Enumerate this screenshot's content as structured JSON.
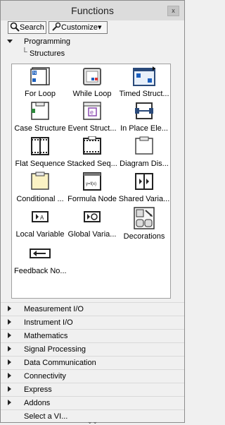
{
  "title": "Functions",
  "close_label": "x",
  "toolbar": {
    "search_label": "Search",
    "customize_label": "Customize",
    "customize_arrow": "▾"
  },
  "tree": {
    "programming": "Programming",
    "structures_connector": "└",
    "structures": "Structures"
  },
  "structures_items": [
    {
      "label": "For Loop",
      "icon": "for-loop-icon"
    },
    {
      "label": "While Loop",
      "icon": "while-loop-icon"
    },
    {
      "label": "Timed Struct...",
      "icon": "timed-structure-icon"
    },
    {
      "label": "Case Structure",
      "icon": "case-structure-icon"
    },
    {
      "label": "Event Struct...",
      "icon": "event-structure-icon"
    },
    {
      "label": "In Place Ele...",
      "icon": "in-place-element-icon"
    },
    {
      "label": "Flat Sequence",
      "icon": "flat-sequence-icon"
    },
    {
      "label": "Stacked Seq...",
      "icon": "stacked-sequence-icon"
    },
    {
      "label": "Diagram Dis...",
      "icon": "diagram-disable-icon"
    },
    {
      "label": "Conditional ...",
      "icon": "conditional-disable-icon"
    },
    {
      "label": "Formula Node",
      "icon": "formula-node-icon"
    },
    {
      "label": "Shared Varia...",
      "icon": "shared-variable-icon"
    },
    {
      "label": "Local Variable",
      "icon": "local-variable-icon"
    },
    {
      "label": "Global Varia...",
      "icon": "global-variable-icon"
    },
    {
      "label": "Decorations",
      "icon": "decorations-icon"
    },
    {
      "label": "Feedback No...",
      "icon": "feedback-node-icon"
    }
  ],
  "categories": [
    "Measurement I/O",
    "Instrument I/O",
    "Mathematics",
    "Signal Processing",
    "Data Communication",
    "Connectivity",
    "Express",
    "Addons"
  ],
  "select_vi": "Select a VI...",
  "more_glyph": "⌄⌄"
}
